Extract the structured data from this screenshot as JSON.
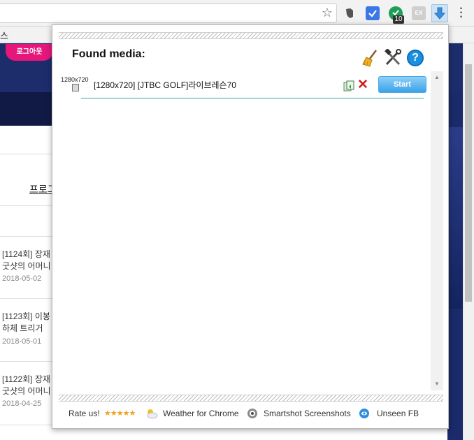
{
  "bookmarks": {
    "partial_text": "스"
  },
  "extensions": {
    "badge_count": "10",
    "ex_label": "EX"
  },
  "page": {
    "logout_label": "로그아웃",
    "link_text": "프로그",
    "news": [
      {
        "title_line1": "[1124회] 장재",
        "title_line2": "굿샷의 어머니",
        "date": "2018-05-02"
      },
      {
        "title_line1": "[1123회] 이봉",
        "title_line2": "하체 트리거 ",
        "date": "2018-05-01"
      },
      {
        "title_line1": "[1122회] 장재",
        "title_line2": "굿샷의 어머니",
        "date": "2018-04-25"
      }
    ]
  },
  "popup": {
    "title": "Found media:",
    "help_label": "?",
    "media": [
      {
        "resolution": "1280x720",
        "title": "[1280x720] [JTBC GOLF]라이브레슨70",
        "start_label": "Start",
        "delete_label": "✕"
      }
    ],
    "footer": {
      "rate_label": "Rate us!",
      "stars": "★★★★★",
      "weather_label": "Weather for Chrome",
      "smartshot_label": "Smartshot Screenshots",
      "unseen_label": "Unseen FB"
    }
  },
  "colors": {
    "accent": "#1d8fe0",
    "start_button": "#3aa2e8",
    "delete": "#d11b1b",
    "page_header": "#1d2d6c",
    "logout_pink": "#e5177b"
  }
}
